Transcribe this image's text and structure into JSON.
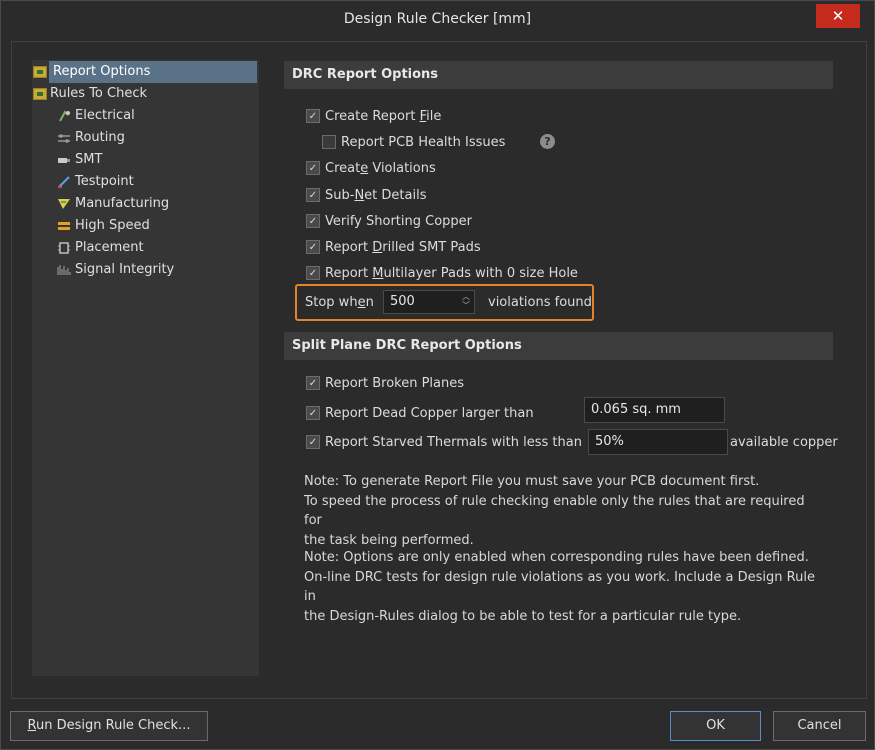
{
  "window": {
    "title": "Design Rule Checker [mm]",
    "close_glyph": "✕"
  },
  "tree": {
    "items": [
      {
        "label": "Report Options",
        "icon": "folder-icon"
      },
      {
        "label": "Rules To Check",
        "icon": "folder-icon"
      },
      {
        "label": "Electrical",
        "icon": "electrical-icon"
      },
      {
        "label": "Routing",
        "icon": "routing-icon"
      },
      {
        "label": "SMT",
        "icon": "smt-icon"
      },
      {
        "label": "Testpoint",
        "icon": "testpoint-icon"
      },
      {
        "label": "Manufacturing",
        "icon": "manufacturing-icon"
      },
      {
        "label": "High Speed",
        "icon": "high-speed-icon"
      },
      {
        "label": "Placement",
        "icon": "placement-icon"
      },
      {
        "label": "Signal Integrity",
        "icon": "signal-integrity-icon"
      }
    ]
  },
  "drc": {
    "header": "DRC Report Options",
    "create_report": {
      "pre": "Create Report ",
      "u": "F",
      "post": "ile",
      "checked": true
    },
    "health": {
      "label": "Report PCB Health Issues",
      "checked": false
    },
    "create_violations": {
      "pre": "Creat",
      "u": "e",
      "post": " Violations",
      "checked": true
    },
    "subnet": {
      "pre": "Sub-",
      "u": "N",
      "post": "et Details",
      "checked": true
    },
    "shorting": {
      "label": "Verify Shorting Copper",
      "checked": true
    },
    "drilled": {
      "pre": "Report ",
      "u": "D",
      "post": "rilled SMT Pads",
      "checked": true
    },
    "multilayer": {
      "pre": "Report ",
      "u": "M",
      "post": "ultilayer Pads with 0 size Hole",
      "checked": true
    },
    "stop": {
      "pre": "Stop wh",
      "u": "e",
      "post": "n",
      "value": "500",
      "suffix": "violations found"
    }
  },
  "split": {
    "header": "Split Plane DRC Report Options",
    "broken": {
      "label": "Report Broken Planes",
      "checked": true
    },
    "dead": {
      "label": "Report Dead Copper larger than",
      "value": "0.065 sq. mm",
      "checked": true
    },
    "starved": {
      "label": "Report Starved Thermals with less than",
      "value": "50%",
      "suffix": "available copper",
      "checked": true
    }
  },
  "notes": {
    "note1": [
      "Note: To generate Report File you must save your PCB document first.",
      "To speed the process of rule checking enable only the rules that are required for",
      "the task being performed."
    ],
    "note2": [
      "Note: Options are only enabled when corresponding rules have been defined.",
      "On-line DRC tests for design rule violations as you work. Include a Design Rule in",
      "the Design-Rules dialog to be able to test for a particular rule  type."
    ]
  },
  "buttons": {
    "run": {
      "u": "R",
      "post": "un Design Rule Check..."
    },
    "ok": "OK",
    "cancel": "Cancel"
  },
  "colors": {
    "accent": "#e8822a",
    "selection": "#5a7287",
    "close": "#c42b1c"
  }
}
